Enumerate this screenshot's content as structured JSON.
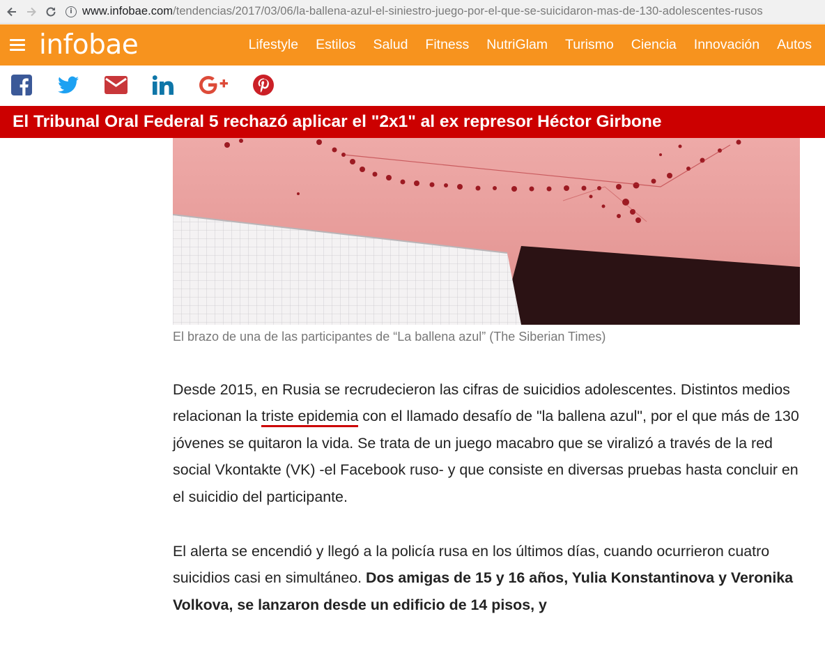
{
  "browser": {
    "url_host": "www.infobae.com",
    "url_path": "/tendencias/2017/03/06/la-ballena-azul-el-siniestro-juego-por-el-que-se-suicidaron-mas-de-130-adolescentes-rusos"
  },
  "header": {
    "logo": "infobae",
    "nav": [
      "Lifestyle",
      "Estilos",
      "Salud",
      "Fitness",
      "NutriGlam",
      "Turismo",
      "Ciencia",
      "Innovación",
      "Autos"
    ]
  },
  "share": {
    "icons": [
      "facebook-icon",
      "twitter-icon",
      "email-icon",
      "linkedin-icon",
      "google-plus-icon",
      "pinterest-icon"
    ],
    "colors": {
      "facebook": "#3b5998",
      "twitter": "#1da1f2",
      "email": "#c8373a",
      "linkedin": "#0e76a8",
      "google": "#dd4b39",
      "pinterest": "#cb2027"
    }
  },
  "breaking": {
    "text": "El Tribunal Oral Federal 5 rechazó aplicar el \"2x1\" al ex represor Héctor Girbone"
  },
  "photo": {
    "caption": "El brazo de una de las participantes de “La ballena azul” (The Siberian Times)"
  },
  "article": {
    "p1_before": "Desde 2015, en Rusia se recrudecieron las cifras de suicidios adolescentes. Distintos medios relacionan la ",
    "p1_link": "triste epidemia",
    "p1_after": " con el llamado desafío de \"la ballena azul\", por el que más de 130 jóvenes se quitaron la vida. Se trata de un juego macabro que se viralizó a través de la red social Vkontakte (VK) -el Facebook ruso- y que consiste en diversas pruebas hasta concluir en el suicidio del participante.",
    "p2_before": "El alerta se encendió y llegó a la policía rusa en los últimos días, cuando ocurrieron cuatro suicidios casi en simultáneo. ",
    "p2_bold": "Dos amigas de 15 y 16 años, Yulia Konstantinova y Veronika Volkova, se lanzaron desde un edificio de 14 pisos, y"
  },
  "colors": {
    "brand_orange": "#f7931e",
    "breaking_red": "#cc0000"
  }
}
